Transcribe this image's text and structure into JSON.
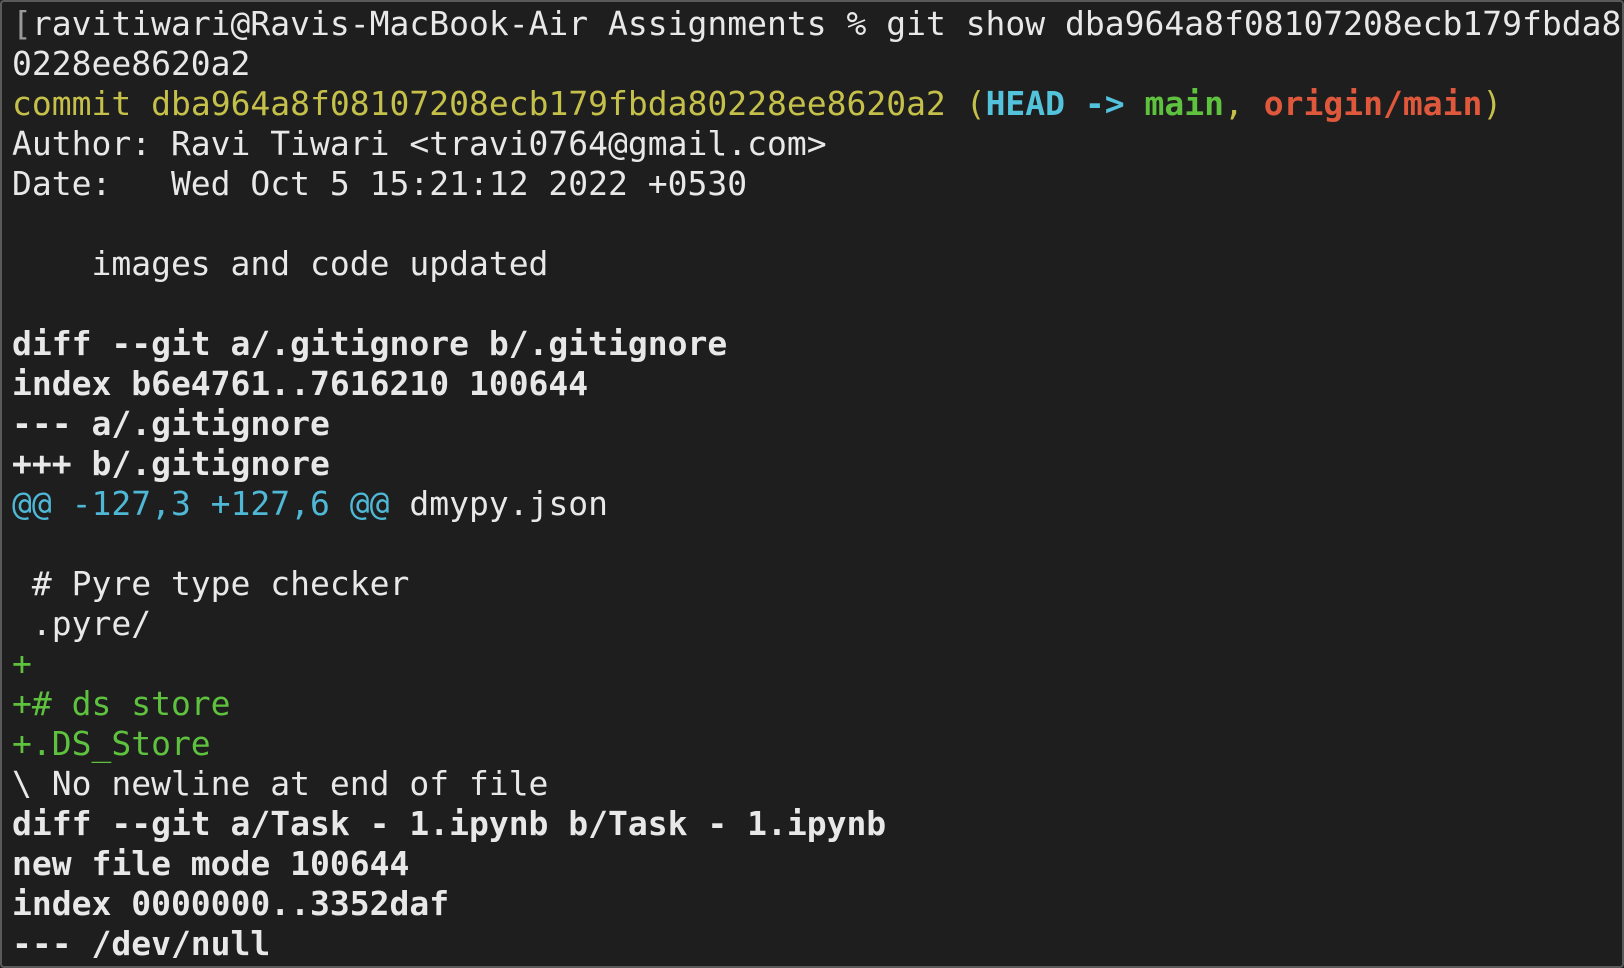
{
  "terminal": {
    "prompt": {
      "bracket": "[",
      "user_host": "ravitiwari@Ravis-MacBook-Air",
      "cwd": "Assignments",
      "symbol": "%",
      "command": "git show dba964a8f08107208ecb179fbda8",
      "command_end_bracket": "]",
      "command_wrap": "0228ee8620a2"
    },
    "commit": {
      "label": "commit",
      "hash": "dba964a8f08107208ecb179fbda80228ee8620a2",
      "open_paren": "(",
      "head": "HEAD",
      "arrow": "->",
      "branch": "main",
      "comma": ",",
      "remote": "origin/main",
      "close_paren": ")"
    },
    "author_line": "Author: Ravi Tiwari <travi0764@gmail.com>",
    "date_line": "Date:   Wed Oct 5 15:21:12 2022 +0530",
    "message": "    images and code updated",
    "diff1": {
      "header": "diff --git a/.gitignore b/.gitignore",
      "index": "index b6e4761..7616210 100644",
      "minus": "--- a/.gitignore",
      "plus": "+++ b/.gitignore",
      "hunk": "@@ -127,3 +127,6 @@",
      "hunk_context": " dmypy.json",
      "context1": " # Pyre type checker",
      "context2": " .pyre/",
      "added1": "+",
      "added2": "+# ds store",
      "added3": "+.DS_Store",
      "no_newline": "\\ No newline at end of file"
    },
    "diff2": {
      "header": "diff --git a/Task - 1.ipynb b/Task - 1.ipynb",
      "mode": "new file mode 100644",
      "index": "index 0000000..3352daf",
      "minus": "--- /dev/null"
    }
  },
  "colors": {
    "background": "#1e1e1e",
    "text": "#e8e8e8",
    "commit_yellow": "#c5c04a",
    "hunk_cyan": "#4fb8d6",
    "added_green": "#5fc23f",
    "remote_red": "#e0583c"
  }
}
